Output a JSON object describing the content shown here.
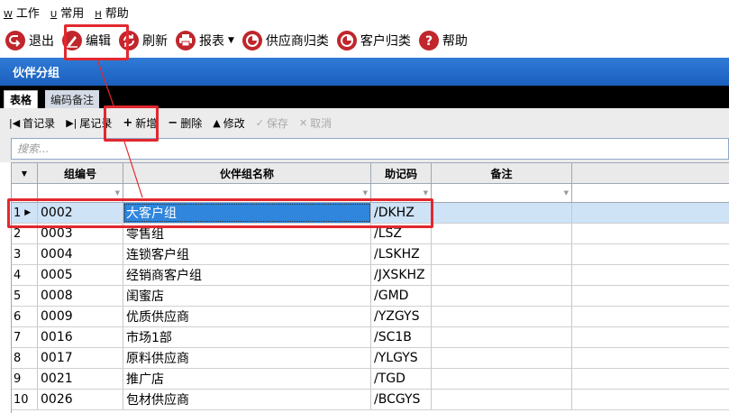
{
  "menubar": {
    "items": [
      {
        "key": "W",
        "label": "工作"
      },
      {
        "key": "U",
        "label": "常用"
      },
      {
        "key": "H",
        "label": "帮助"
      }
    ]
  },
  "toolbar": {
    "exit_label": "退出",
    "edit_label": "编辑",
    "refresh_label": "刷新",
    "report_label": "报表",
    "supplier_label": "供应商归类",
    "customer_label": "客户归类",
    "help_label": "帮助"
  },
  "section": {
    "title": "伙伴分组"
  },
  "tabs": [
    {
      "label": "表格",
      "active": true
    },
    {
      "label": "编码备注",
      "active": false
    }
  ],
  "navbar": {
    "first_label": "首记录",
    "last_label": "尾记录",
    "add_label": "新增",
    "delete_label": "删除",
    "modify_label": "修改",
    "save_label": "保存",
    "cancel_label": "取消"
  },
  "search": {
    "placeholder": "搜索..."
  },
  "grid": {
    "columns": [
      "组编号",
      "伙伴组名称",
      "助记码",
      "备注"
    ],
    "rows": [
      {
        "num": "1",
        "code": "0002",
        "name": "大客户组",
        "mnemonic": "/DKHZ",
        "note": ""
      },
      {
        "num": "2",
        "code": "0003",
        "name": "零售组",
        "mnemonic": "/LSZ",
        "note": ""
      },
      {
        "num": "3",
        "code": "0004",
        "name": "连锁客户组",
        "mnemonic": "/LSKHZ",
        "note": ""
      },
      {
        "num": "4",
        "code": "0005",
        "name": "经销商客户组",
        "mnemonic": "/JXSKHZ",
        "note": ""
      },
      {
        "num": "5",
        "code": "0008",
        "name": "闺蜜店",
        "mnemonic": "/GMD",
        "note": ""
      },
      {
        "num": "6",
        "code": "0009",
        "name": "优质供应商",
        "mnemonic": "/YZGYS",
        "note": ""
      },
      {
        "num": "7",
        "code": "0016",
        "name": "市场1部",
        "mnemonic": "/SC1B",
        "note": ""
      },
      {
        "num": "8",
        "code": "0017",
        "name": "原料供应商",
        "mnemonic": "/YLGYS",
        "note": ""
      },
      {
        "num": "9",
        "code": "0021",
        "name": "推广店",
        "mnemonic": "/TGD",
        "note": ""
      },
      {
        "num": "10",
        "code": "0026",
        "name": "包材供应商",
        "mnemonic": "/BCGYS",
        "note": ""
      }
    ]
  },
  "colors": {
    "header_blue": "#1b5fbe",
    "selection_blue": "#2f86dc",
    "annotation_red": "#e2282f"
  }
}
